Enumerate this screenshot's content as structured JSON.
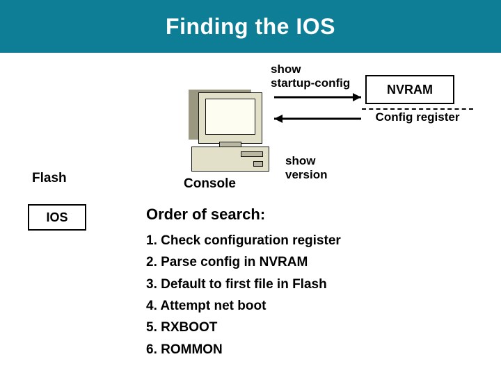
{
  "title": "Finding the IOS",
  "left": {
    "flash_label": "Flash",
    "ios_label": "IOS"
  },
  "center": {
    "console_label": "Console"
  },
  "right": {
    "nvram_label": "NVRAM",
    "config_register_label": "Config register"
  },
  "commands": {
    "startup_line1": "show",
    "startup_line2": "startup-config",
    "version_line1": "show",
    "version_line2": "version"
  },
  "order": {
    "heading": "Order of search:",
    "items": [
      "1. Check configuration register",
      "2. Parse config in NVRAM",
      "3. Default to first file in Flash",
      "4. Attempt net boot",
      "5. RXBOOT",
      "6. ROMMON"
    ]
  }
}
